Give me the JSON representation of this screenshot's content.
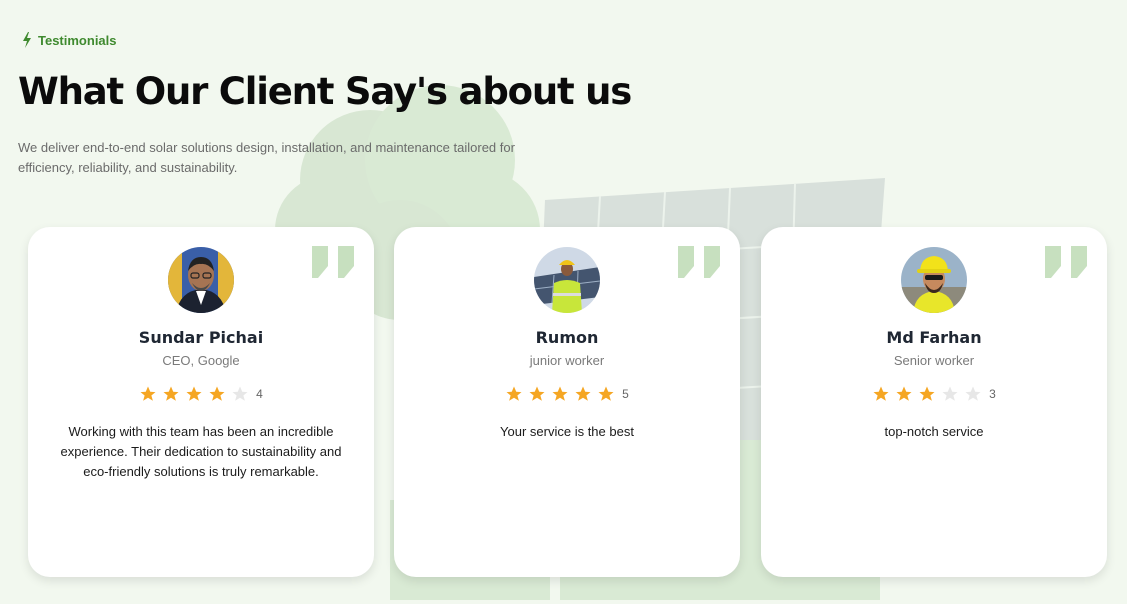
{
  "header": {
    "tag_label": "Testimonials",
    "title": "What Our Client Say's about us",
    "description": "We deliver end-to-end solar solutions design, installation, and maintenance tailored for efficiency, reliability, and sustainability."
  },
  "colors": {
    "accent": "#3f8a2f",
    "star_filled": "#f5a623",
    "star_empty": "#e7e7e7",
    "quote_mark": "#c7e0bf"
  },
  "testimonials": [
    {
      "name": "Sundar Pichai",
      "role": "CEO, Google",
      "rating": 4,
      "rating_label": "4",
      "message": "Working with this team has been an incredible experience. Their dedication to sustainability and eco-friendly solutions is truly remarkable."
    },
    {
      "name": "Rumon",
      "role": "junior worker",
      "rating": 5,
      "rating_label": "5",
      "message": "Your service is the best"
    },
    {
      "name": "Md Farhan",
      "role": "Senior worker",
      "rating": 3,
      "rating_label": "3",
      "message": "top-notch service"
    }
  ],
  "icons": {
    "tag": "lightning-icon",
    "quote": "quote-mark-icon",
    "star": "star-icon"
  }
}
